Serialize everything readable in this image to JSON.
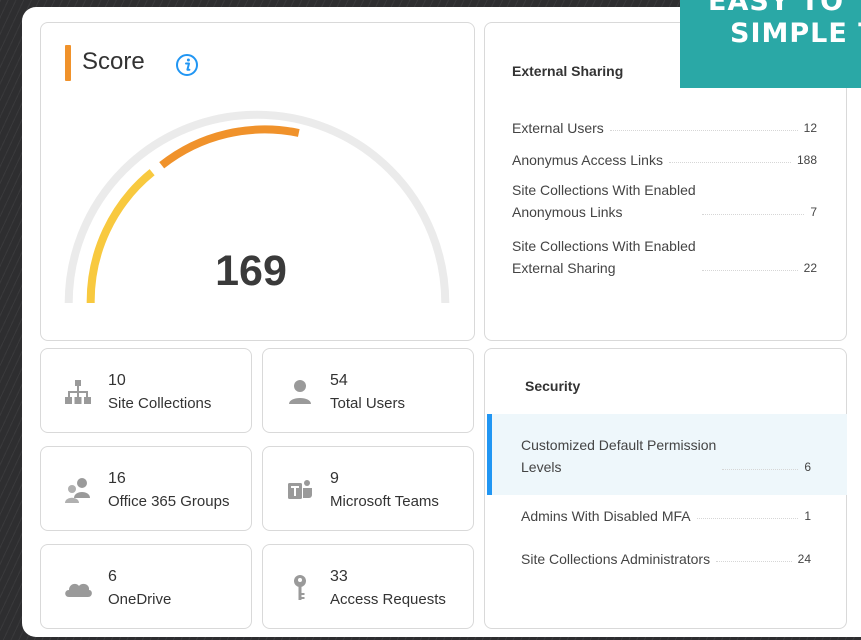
{
  "banner": {
    "line1": "EASY TO",
    "line2": "SIMPLE T"
  },
  "score": {
    "title": "Score",
    "value": "169",
    "info_icon": "info-icon",
    "accent_color": "#f0922b",
    "gauge_yellow": "#f8c93f",
    "gauge_track": "#ebebeb"
  },
  "external_sharing": {
    "title": "External Sharing",
    "rows": [
      {
        "label": "External Users",
        "value": "12"
      },
      {
        "label": "Anonymus Access Links",
        "value": "188"
      },
      {
        "label": "Site Collections With Enabled\nAnonymous Links",
        "value": "7"
      },
      {
        "label": "Site Collections With Enabled\nExternal Sharing",
        "value": "22"
      }
    ]
  },
  "tiles": [
    {
      "value": "10",
      "label": "Site Collections",
      "icon": "sitemap-icon"
    },
    {
      "value": "54",
      "label": "Total Users",
      "icon": "user-icon"
    },
    {
      "value": "16",
      "label": "Office 365 Groups",
      "icon": "group-icon"
    },
    {
      "value": "9",
      "label": "Microsoft Teams",
      "icon": "teams-icon"
    },
    {
      "value": "6",
      "label": "OneDrive",
      "icon": "cloud-icon"
    },
    {
      "value": "33",
      "label": "Access Requests",
      "icon": "key-icon"
    }
  ],
  "security": {
    "title": "Security",
    "highlight_color": "#2196f3",
    "rows": [
      {
        "label": "Customized Default Permission\nLevels",
        "value": "6"
      },
      {
        "label": "Admins With Disabled MFA",
        "value": "1"
      },
      {
        "label": "Site Collections Administrators",
        "value": "24"
      }
    ]
  }
}
